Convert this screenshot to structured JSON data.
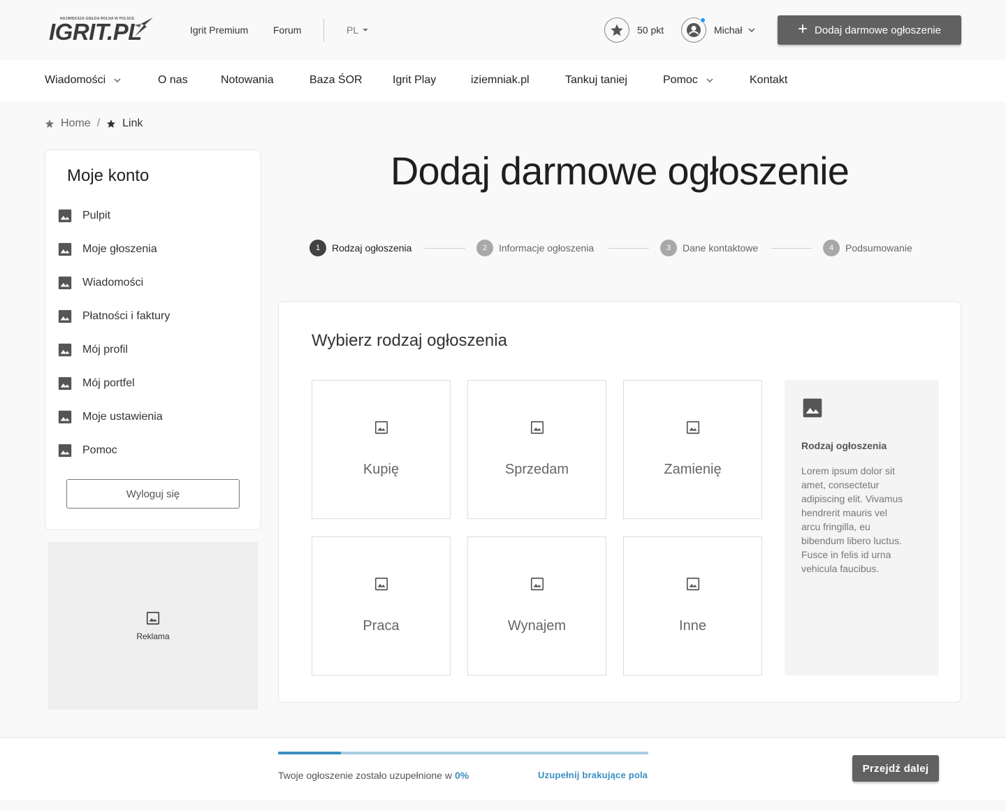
{
  "header": {
    "logo_text": "IGRIT.PL",
    "logo_tagline": "NAJWIĘKSZA GIEŁDA ROLNA W POLSCE",
    "links": [
      "Igrit Premium",
      "Forum"
    ],
    "language": "PL",
    "points": "50 pkt",
    "user_name": "Michał",
    "add_button": "Dodaj darmowe ogłoszenie",
    "notification_color": "#2196f3"
  },
  "nav": {
    "items": [
      {
        "label": "Wiadomości",
        "has_dropdown": true
      },
      {
        "label": "O nas",
        "has_dropdown": false
      },
      {
        "label": "Notowania",
        "has_dropdown": false
      },
      {
        "label": "Baza ŚOR",
        "has_dropdown": false
      },
      {
        "label": "Igrit Play",
        "has_dropdown": false
      },
      {
        "label": "iziemniak.pl",
        "has_dropdown": false
      },
      {
        "label": "Tankuj taniej",
        "has_dropdown": false
      },
      {
        "label": "Pomoc",
        "has_dropdown": true
      },
      {
        "label": "Kontakt",
        "has_dropdown": false
      }
    ]
  },
  "breadcrumb": {
    "items": [
      "Home",
      "Link"
    ],
    "separator": "/"
  },
  "sidebar": {
    "title": "Moje konto",
    "items": [
      {
        "label": "Pulpit",
        "icon": "image-icon"
      },
      {
        "label": "Moje głoszenia",
        "icon": "image-icon"
      },
      {
        "label": "Wiadomości",
        "icon": "image-icon"
      },
      {
        "label": "Płatności i faktury",
        "icon": "image-icon"
      },
      {
        "label": "Mój profil",
        "icon": "image-icon"
      },
      {
        "label": "Mój portfel",
        "icon": "image-icon"
      },
      {
        "label": "Moje ustawienia",
        "icon": "image-icon"
      },
      {
        "label": "Pomoc",
        "icon": "image-icon"
      }
    ],
    "logout": "Wyloguj się",
    "ad_label": "Reklama"
  },
  "main": {
    "title": "Dodaj darmowe ogłoszenie",
    "steps": [
      {
        "num": "1",
        "label": "Rodzaj ogłoszenia",
        "active": true
      },
      {
        "num": "2",
        "label": "Informacje ogłoszenia",
        "active": false
      },
      {
        "num": "3",
        "label": "Dane kontaktowe",
        "active": false
      },
      {
        "num": "4",
        "label": "Podsumowanie",
        "active": false
      }
    ],
    "card_heading": "Wybierz rodzaj ogłoszenia",
    "types": [
      "Kupię",
      "Sprzedam",
      "Zamienię",
      "Praca",
      "Wynajem",
      "Inne"
    ],
    "info": {
      "title": "Rodzaj ogłoszenia",
      "body": "Lorem ipsum dolor sit amet, consectetur adipiscing elit. Vivamus hendrerit mauris vel arcu fringilla, eu bibendum libero luctus. Fusce in felis id urna vehicula faucibus."
    }
  },
  "footer": {
    "progress_text": "Twoje ogłoszenie zostało uzupełnione w",
    "progress_value": "0%",
    "progress_fraction": 0.17,
    "missing_link": "Uzupełnij brakujące pola",
    "next_button": "Przejdź dalej",
    "accent_color": "#3a8fc2"
  }
}
